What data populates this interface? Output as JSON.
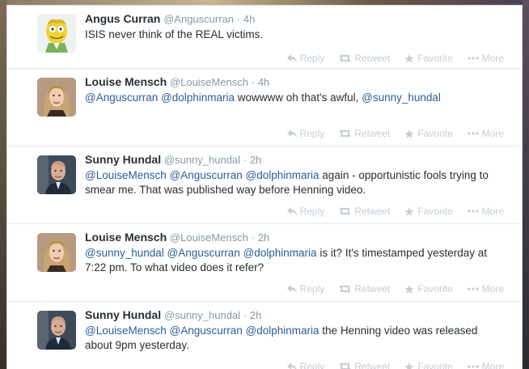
{
  "tweets": [
    {
      "fullname": "Angus Curran",
      "username": "@Anguscurran",
      "separator": "·",
      "time": "4h",
      "segments": [
        {
          "text": "ISIS never think of the REAL victims.",
          "mention": false
        }
      ],
      "avatar": "cartoon-avatar"
    },
    {
      "fullname": "Louise Mensch",
      "username": "@LouiseMensch",
      "separator": "·",
      "time": "4h",
      "segments": [
        {
          "text": "@Anguscurran",
          "mention": true
        },
        {
          "text": " ",
          "mention": false
        },
        {
          "text": "@dolphinmaria",
          "mention": true
        },
        {
          "text": " wowwww oh that's awful, ",
          "mention": false
        },
        {
          "text": "@sunny_hundal",
          "mention": true
        }
      ],
      "avatar": "woman-avatar"
    },
    {
      "fullname": "Sunny Hundal",
      "username": "@sunny_hundal",
      "separator": "·",
      "time": "2h",
      "segments": [
        {
          "text": "@LouiseMensch",
          "mention": true
        },
        {
          "text": " ",
          "mention": false
        },
        {
          "text": "@Anguscurran",
          "mention": true
        },
        {
          "text": " ",
          "mention": false
        },
        {
          "text": "@dolphinmaria",
          "mention": true
        },
        {
          "text": " again - opportunistic fools trying to smear me. That was published way before Henning video.",
          "mention": false
        }
      ],
      "avatar": "man-avatar"
    },
    {
      "fullname": "Louise Mensch",
      "username": "@LouiseMensch",
      "separator": "·",
      "time": "2h",
      "segments": [
        {
          "text": "@sunny_hundal",
          "mention": true
        },
        {
          "text": " ",
          "mention": false
        },
        {
          "text": "@Anguscurran",
          "mention": true
        },
        {
          "text": " ",
          "mention": false
        },
        {
          "text": "@dolphinmaria",
          "mention": true
        },
        {
          "text": " is it? It's timestamped yesterday at 7:22 pm. To what video does it refer?",
          "mention": false
        }
      ],
      "avatar": "woman-avatar"
    },
    {
      "fullname": "Sunny Hundal",
      "username": "@sunny_hundal",
      "separator": "·",
      "time": "2h",
      "segments": [
        {
          "text": "@LouiseMensch",
          "mention": true
        },
        {
          "text": " ",
          "mention": false
        },
        {
          "text": "@Anguscurran",
          "mention": true
        },
        {
          "text": " ",
          "mention": false
        },
        {
          "text": "@dolphinmaria",
          "mention": true
        },
        {
          "text": " the Henning video was released about 9pm yesterday.",
          "mention": false
        }
      ],
      "avatar": "man-avatar"
    }
  ],
  "actions": {
    "reply_label": "Reply",
    "retweet_label": "Retweet",
    "favorite_label": "Favorite",
    "more_label": "More",
    "reply_icon": "reply-icon",
    "retweet_icon": "retweet-icon",
    "favorite_icon": "star-icon",
    "more_icon": "more-dots-icon"
  },
  "colors": {
    "mention": "#2c5d9a",
    "name": "#292f33",
    "meta": "#8899a6",
    "action": "#c5cdd3"
  }
}
